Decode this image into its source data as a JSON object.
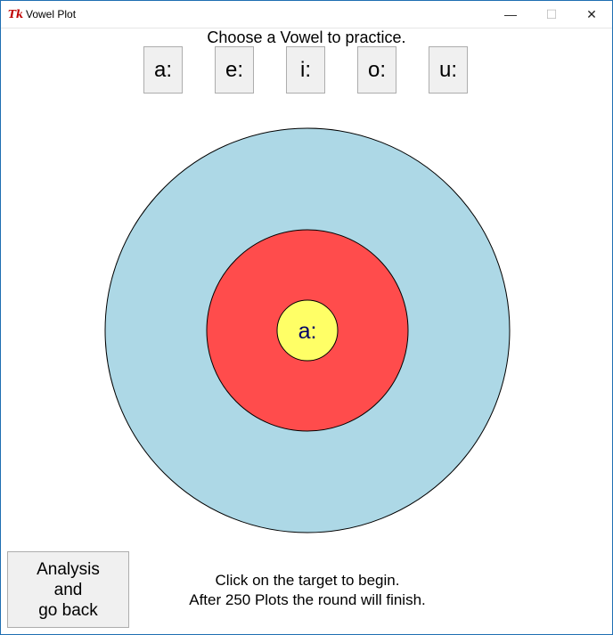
{
  "window": {
    "title": "Vowel Plot",
    "app_icon": "tk-feather-icon",
    "controls": {
      "minimize": "—",
      "maximize": "☐",
      "close": "✕"
    }
  },
  "prompt": "Choose a Vowel to practice.",
  "vowels": [
    "a:",
    "e:",
    "i:",
    "o:",
    "u:"
  ],
  "target": {
    "center_label": "a:",
    "colors": {
      "outer": "#add8e6",
      "middle": "#ff4c4c",
      "inner": "#ffff66",
      "label": "#000066"
    }
  },
  "analysis_button": {
    "lines": [
      "Analysis",
      "and",
      "go back"
    ]
  },
  "info": {
    "line1": "Click on the target to begin.",
    "line2": "After 250 Plots the round will finish."
  }
}
